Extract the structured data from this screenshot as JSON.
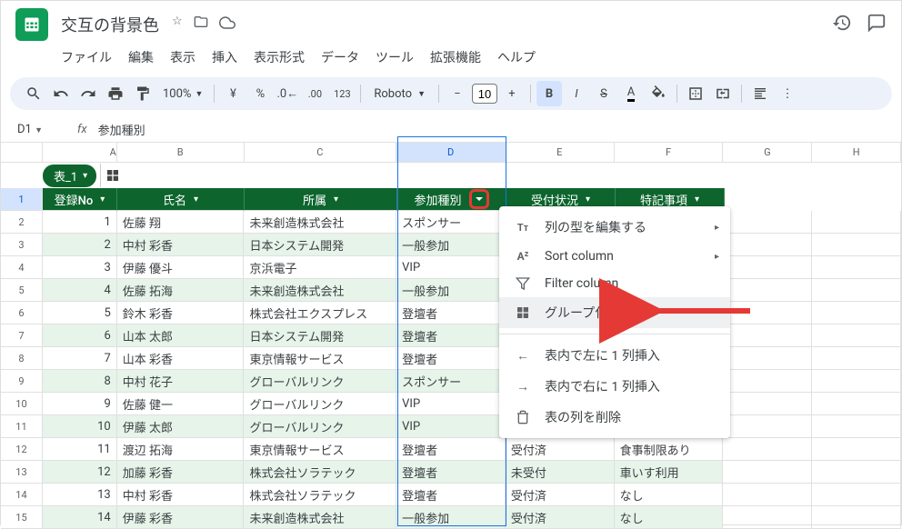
{
  "doc": {
    "title": "交互の背景色"
  },
  "menus": [
    "ファイル",
    "編集",
    "表示",
    "挿入",
    "表示形式",
    "データ",
    "ツール",
    "拡張機能",
    "ヘルプ"
  ],
  "toolbar": {
    "zoom": "100%",
    "font": "Roboto",
    "size": "10"
  },
  "cellref": {
    "ref": "D1",
    "value": "参加種別"
  },
  "colLetters": [
    "A",
    "B",
    "C",
    "D",
    "E",
    "F",
    "G",
    "H"
  ],
  "tableChip": {
    "name": "表_1"
  },
  "headers": {
    "no": "登録No",
    "name": "氏名",
    "org": "所属",
    "type": "参加種別",
    "stat": "受付状況",
    "note": "特記事項"
  },
  "rows": [
    {
      "no": "1",
      "name": "佐藤 翔",
      "org": "未来創造株式会社",
      "type": "スポンサー",
      "stat": "",
      "note": ""
    },
    {
      "no": "2",
      "name": "中村 彩香",
      "org": "日本システム開発",
      "type": "一般参加",
      "stat": "",
      "note": ""
    },
    {
      "no": "3",
      "name": "伊藤 優斗",
      "org": "京浜電子",
      "type": "VIP",
      "stat": "",
      "note": ""
    },
    {
      "no": "4",
      "name": "佐藤 拓海",
      "org": "未来創造株式会社",
      "type": "一般参加",
      "stat": "",
      "note": ""
    },
    {
      "no": "5",
      "name": "鈴木 彩香",
      "org": "株式会社エクスプレス",
      "type": "登壇者",
      "stat": "",
      "note": ""
    },
    {
      "no": "6",
      "name": "山本 太郎",
      "org": "日本システム開発",
      "type": "登壇者",
      "stat": "",
      "note": ""
    },
    {
      "no": "7",
      "name": "山本 彩香",
      "org": "東京情報サービス",
      "type": "登壇者",
      "stat": "",
      "note": ""
    },
    {
      "no": "8",
      "name": "中村 花子",
      "org": "グローバルリンク",
      "type": "スポンサー",
      "stat": "",
      "note": ""
    },
    {
      "no": "9",
      "name": "佐藤 健一",
      "org": "グローバルリンク",
      "type": "VIP",
      "stat": "",
      "note": ""
    },
    {
      "no": "10",
      "name": "伊藤 太郎",
      "org": "グローバルリンク",
      "type": "VIP",
      "stat": "",
      "note": ""
    },
    {
      "no": "11",
      "name": "渡辺 拓海",
      "org": "東京情報サービス",
      "type": "登壇者",
      "stat": "受付済",
      "note": "食事制限あり"
    },
    {
      "no": "12",
      "name": "加藤 彩香",
      "org": "株式会社ソラテック",
      "type": "登壇者",
      "stat": "未受付",
      "note": "車いす利用"
    },
    {
      "no": "13",
      "name": "中村 彩香",
      "org": "株式会社ソラテック",
      "type": "登壇者",
      "stat": "受付済",
      "note": "なし"
    },
    {
      "no": "14",
      "name": "伊藤 彩香",
      "org": "未来創造株式会社",
      "type": "一般参加",
      "stat": "受付済",
      "note": "なし"
    }
  ],
  "ctx": {
    "editType": "列の型を編集する",
    "sort": "Sort column",
    "filter": "Filter column",
    "group": "グループ化の列",
    "insLeft": "表内で左に 1 列挿入",
    "insRight": "表内で右に 1 列挿入",
    "delCol": "表の列を削除"
  }
}
